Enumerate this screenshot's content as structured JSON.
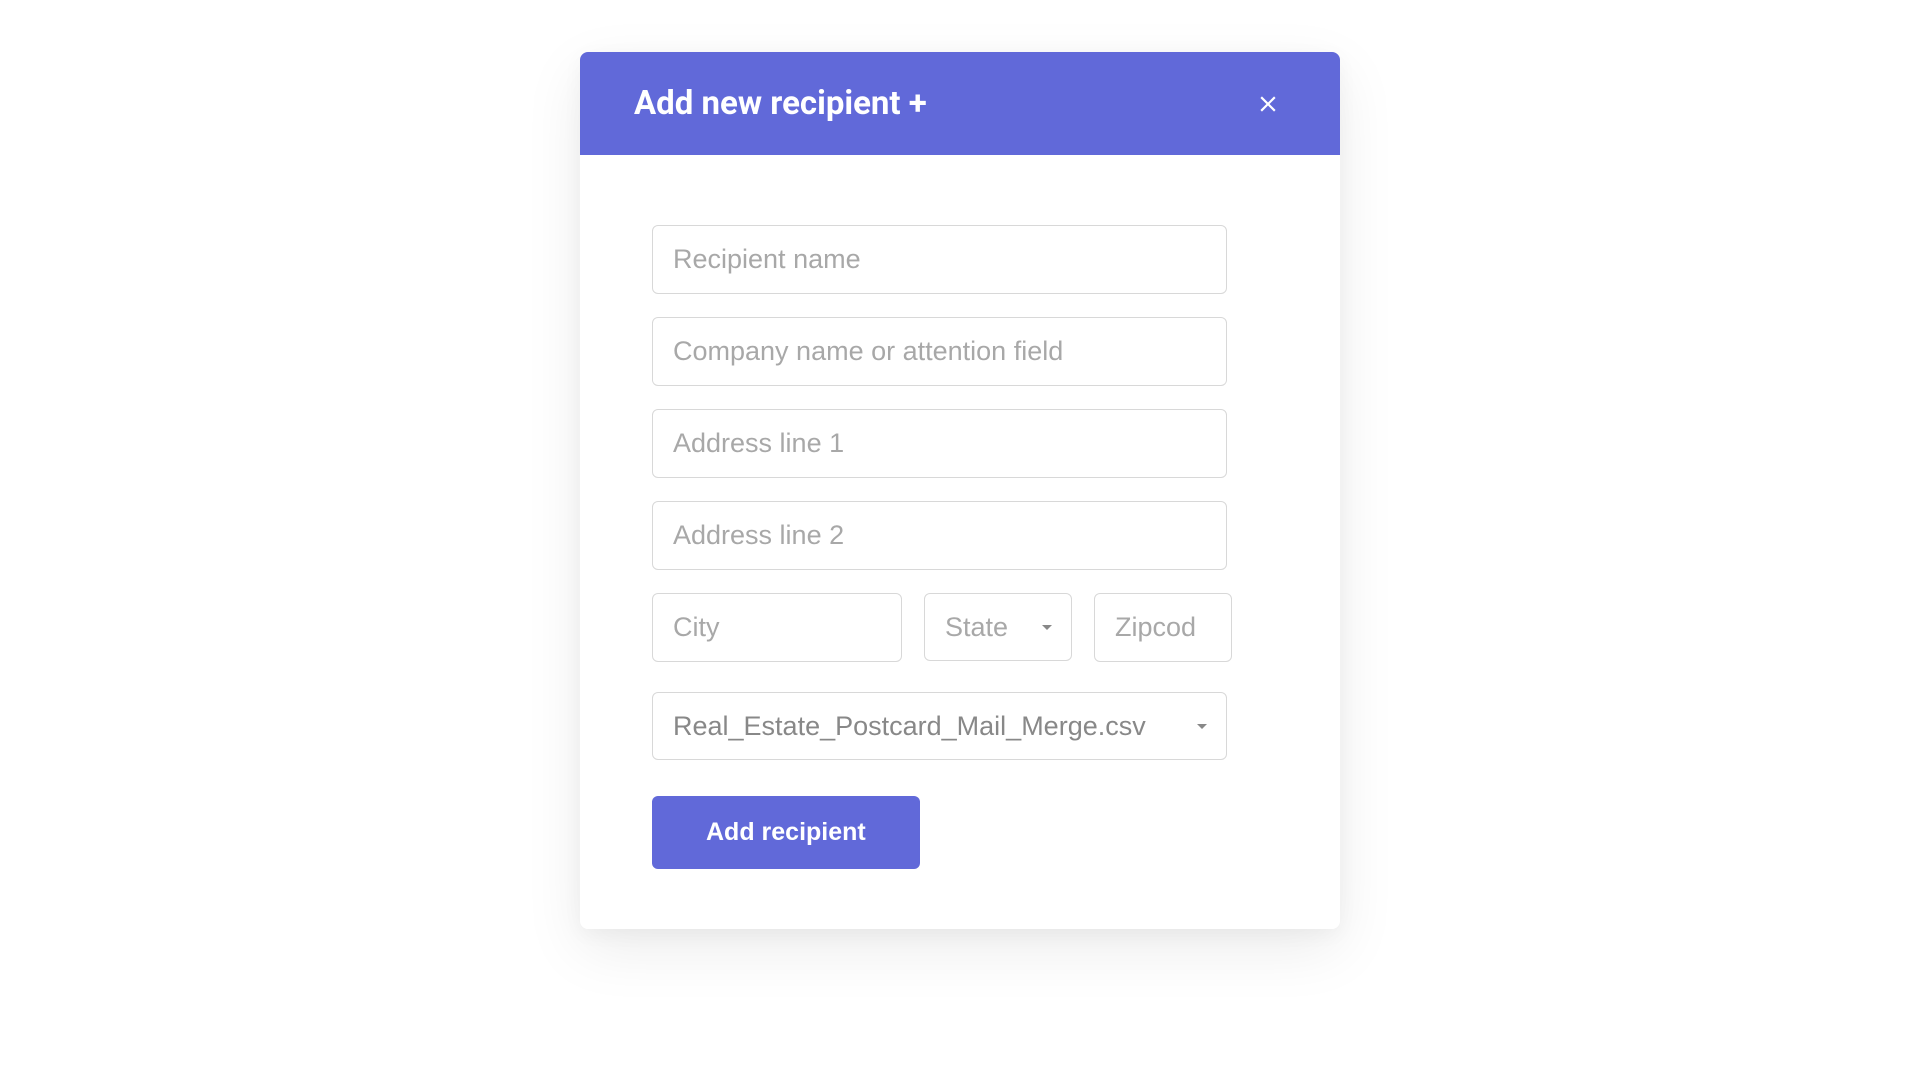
{
  "modal": {
    "title": "Add new recipient +",
    "close_label": "Close"
  },
  "form": {
    "recipient_name": {
      "placeholder": "Recipient name",
      "value": ""
    },
    "company_name": {
      "placeholder": "Company name or attention field",
      "value": ""
    },
    "address_line_1": {
      "placeholder": "Address line 1",
      "value": ""
    },
    "address_line_2": {
      "placeholder": "Address line 2",
      "value": ""
    },
    "city": {
      "placeholder": "City",
      "value": ""
    },
    "state": {
      "placeholder": "State",
      "value": ""
    },
    "zipcode": {
      "placeholder": "Zipcod",
      "value": ""
    },
    "file": {
      "selected": "Real_Estate_Postcard_Mail_Merge.csv"
    },
    "submit_label": "Add recipient"
  },
  "colors": {
    "primary": "#6169d9",
    "border": "#d8d8d8",
    "placeholder": "#a8a8a8"
  }
}
